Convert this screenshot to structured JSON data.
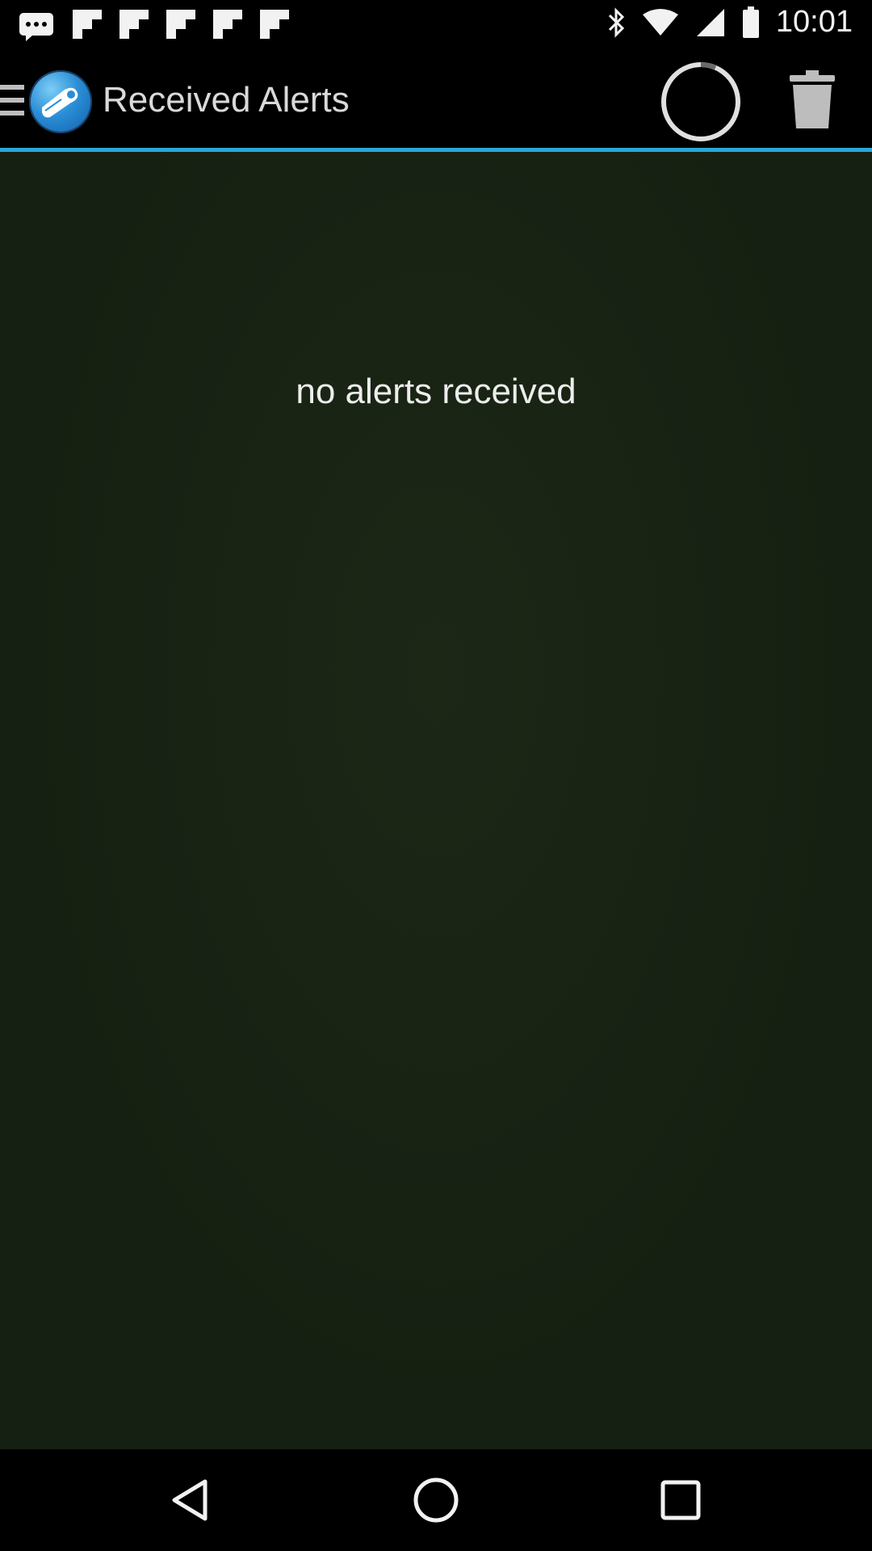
{
  "status_bar": {
    "time": "10:01",
    "left_icons": [
      "message-icon",
      "flipboard-icon",
      "flipboard-icon",
      "flipboard-icon",
      "flipboard-icon",
      "flipboard-icon"
    ],
    "right_icons": [
      "bluetooth-icon",
      "wifi-icon",
      "signal-icon",
      "battery-icon"
    ]
  },
  "app_bar": {
    "title": "Received Alerts",
    "accent_color": "#2aa9d9"
  },
  "content": {
    "empty_message": "no alerts received"
  },
  "nav_bar": {
    "buttons": [
      "back-icon",
      "home-icon",
      "recents-icon"
    ]
  }
}
